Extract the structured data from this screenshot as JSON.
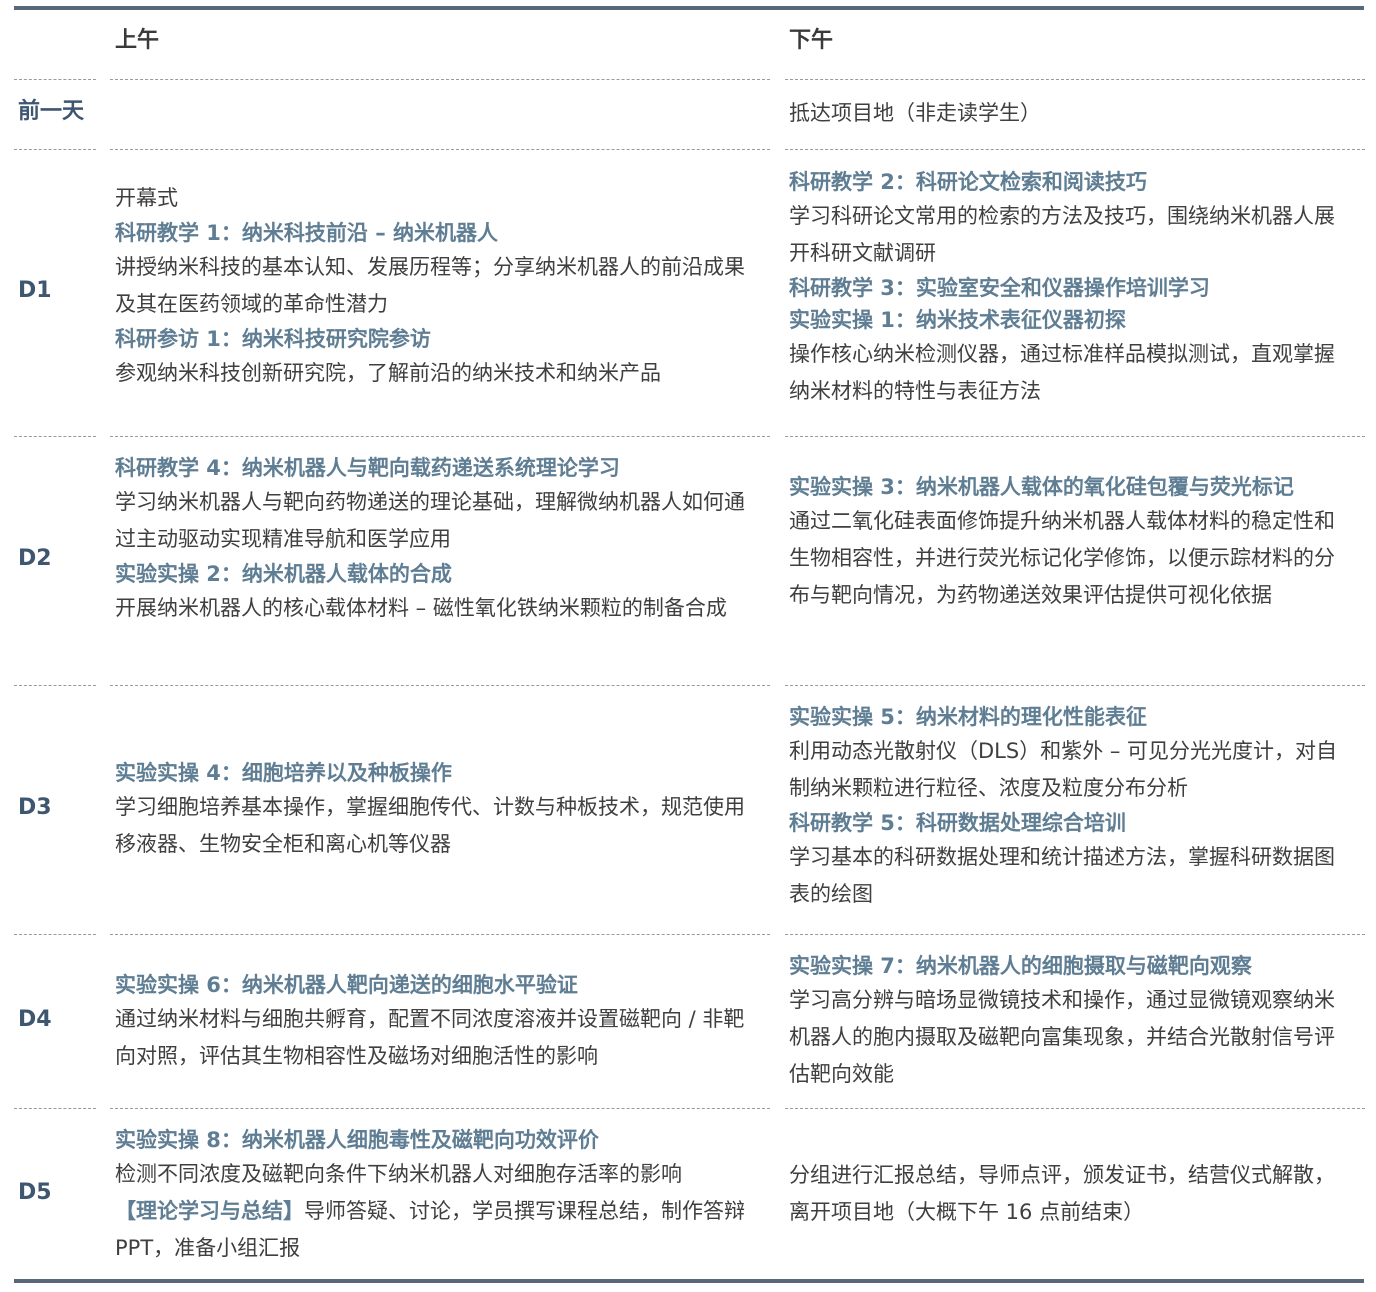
{
  "header": {
    "morning": "上午",
    "afternoon": "下午"
  },
  "rows": [
    {
      "day": "前一天",
      "morning": [],
      "afternoon": [
        {
          "type": "p",
          "text": "抵达项目地（非走读学生）"
        }
      ]
    },
    {
      "day": "D1",
      "morning": [
        {
          "type": "p",
          "text": "开幕式"
        },
        {
          "type": "t",
          "text": "科研教学 1：纳米科技前沿 – 纳米机器人"
        },
        {
          "type": "d",
          "text": "讲授纳米科技的基本认知、发展历程等；分享纳米机器人的前沿成果及其在医药领域的革命性潜力"
        },
        {
          "type": "t",
          "text": "科研参访 1：纳米科技研究院参访"
        },
        {
          "type": "d",
          "text": "参观纳米科技创新研究院，了解前沿的纳米技术和纳米产品"
        }
      ],
      "afternoon": [
        {
          "type": "t",
          "text": "科研教学 2：科研论文检索和阅读技巧"
        },
        {
          "type": "d",
          "text": "学习科研论文常用的检索的方法及技巧，围绕纳米机器人展开科研文献调研"
        },
        {
          "type": "t",
          "text": "科研教学 3：实验室安全和仪器操作培训学习"
        },
        {
          "type": "t",
          "text": "实验实操 1：纳米技术表征仪器初探"
        },
        {
          "type": "d",
          "text": "操作核心纳米检测仪器，通过标准样品模拟测试，直观掌握纳米材料的特性与表征方法"
        }
      ]
    },
    {
      "day": "D2",
      "morning": [
        {
          "type": "t",
          "text": "科研教学 4：纳米机器人与靶向载药递送系统理论学习"
        },
        {
          "type": "d",
          "text": "学习纳米机器人与靶向药物递送的理论基础，理解微纳机器人如何通过主动驱动实现精准导航和医学应用"
        },
        {
          "type": "t",
          "text": "实验实操 2：纳米机器人载体的合成"
        },
        {
          "type": "d",
          "text": "开展纳米机器人的核心载体材料 – 磁性氧化铁纳米颗粒的制备合成"
        }
      ],
      "afternoon": [
        {
          "type": "t",
          "text": "实验实操 3：纳米机器人载体的氧化硅包覆与荧光标记"
        },
        {
          "type": "d",
          "text": "通过二氧化硅表面修饰提升纳米机器人载体材料的稳定性和生物相容性，并进行荧光标记化学修饰，以便示踪材料的分布与靶向情况，为药物递送效果评估提供可视化依据"
        }
      ]
    },
    {
      "day": "D3",
      "morning": [
        {
          "type": "t",
          "text": "实验实操 4：细胞培养以及种板操作"
        },
        {
          "type": "d",
          "text": "学习细胞培养基本操作，掌握细胞传代、计数与种板技术，规范使用移液器、生物安全柜和离心机等仪器"
        }
      ],
      "afternoon": [
        {
          "type": "t",
          "text": "实验实操 5：纳米材料的理化性能表征"
        },
        {
          "type": "d",
          "text": "利用动态光散射仪（DLS）和紫外 – 可见分光光度计，对自制纳米颗粒进行粒径、浓度及粒度分布分析"
        },
        {
          "type": "t",
          "text": "科研教学 5：科研数据处理综合培训"
        },
        {
          "type": "d",
          "text": "学习基本的科研数据处理和统计描述方法，掌握科研数据图表的绘图"
        }
      ]
    },
    {
      "day": "D4",
      "morning": [
        {
          "type": "t",
          "text": "实验实操 6：纳米机器人靶向递送的细胞水平验证"
        },
        {
          "type": "d",
          "text": "通过纳米材料与细胞共孵育，配置不同浓度溶液并设置磁靶向 / 非靶向对照，评估其生物相容性及磁场对细胞活性的影响"
        }
      ],
      "afternoon": [
        {
          "type": "t",
          "text": "实验实操 7：纳米机器人的细胞摄取与磁靶向观察"
        },
        {
          "type": "d",
          "text": "学习高分辨与暗场显微镜技术和操作，通过显微镜观察纳米机器人的胞内摄取及磁靶向富集现象，并结合光散射信号评估靶向效能"
        }
      ]
    },
    {
      "day": "D5",
      "morning": [
        {
          "type": "t",
          "text": "实验实操 8：纳米机器人细胞毒性及磁靶向功效评价"
        },
        {
          "type": "d",
          "text": "检测不同浓度及磁靶向条件下纳米机器人对细胞存活率的影响"
        },
        {
          "type": "m",
          "title": "【理论学习与总结】",
          "text": "导师答疑、讨论，学员撰写课程总结，制作答辩 PPT，准备小组汇报"
        }
      ],
      "afternoon": [
        {
          "type": "d",
          "text": "分组进行汇报总结，导师点评，颁发证书，结营仪式解散，离开项目地（大概下午 16 点前结束）"
        }
      ]
    }
  ]
}
